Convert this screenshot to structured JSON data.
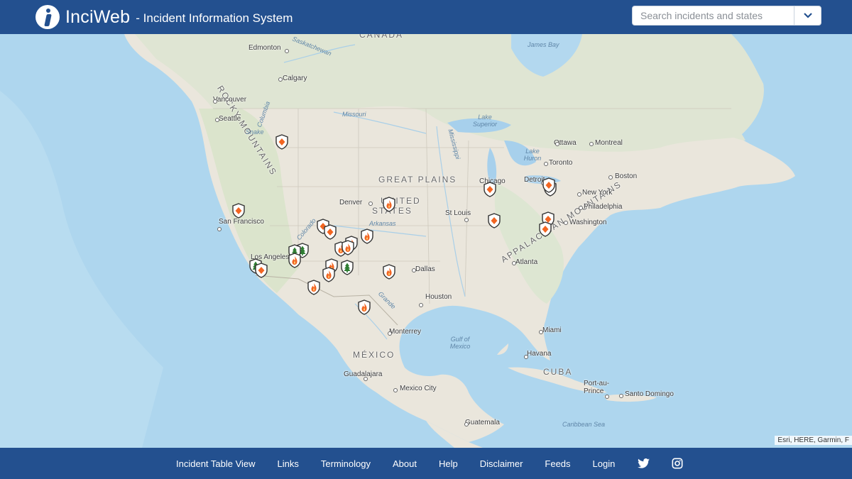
{
  "header": {
    "brand": "InciWeb",
    "tagline": "- Incident Information System",
    "search_placeholder": "Search incidents and states"
  },
  "map": {
    "attribution": "Esri, HERE, Garmin, F",
    "regions": [
      "CANADA",
      "ROCKY MOUNTAINS",
      "GREAT PLAINS",
      "UNITED",
      "STATES",
      "MÉXICO",
      "APPALACHIAN MOUNTAINS",
      "CUBA"
    ],
    "cities": [
      "Edmonton",
      "Saskatchewan",
      "James Bay",
      "Calgary",
      "Vancouver",
      "Seattle",
      "Columbia",
      "Snake",
      "Missouri",
      "Lake Superior",
      "Ottawa",
      "Montreal",
      "Lake Huron",
      "Toronto",
      "Boston",
      "Chicago",
      "Detroit",
      "New York",
      "Philadelphia",
      "Washington",
      "Denver",
      "St Louis",
      "Mississippi",
      "Arkansas",
      "Colorado",
      "San Francisco",
      "Los Angeles",
      "Dallas",
      "Atlanta",
      "Houston",
      "Grande",
      "Miami",
      "Monterrey",
      "Gulf of Mexico",
      "Havana",
      "Guadalajara",
      "Mexico City",
      "Port-au-Prince",
      "Santo Domingo",
      "Guatemala",
      "Caribbean Sea"
    ],
    "markers": [
      "wildfire",
      "prescribed-fire",
      "forest-incident"
    ]
  },
  "footer": {
    "links": [
      "Incident Table View",
      "Links",
      "Terminology",
      "About",
      "Help",
      "Disclaimer",
      "Feeds",
      "Login"
    ],
    "icons": [
      "twitter-icon",
      "instagram-icon"
    ]
  },
  "colors": {
    "header_bg": "#23508f",
    "marker_orange": "#f26522",
    "marker_green": "#2e7d32"
  }
}
